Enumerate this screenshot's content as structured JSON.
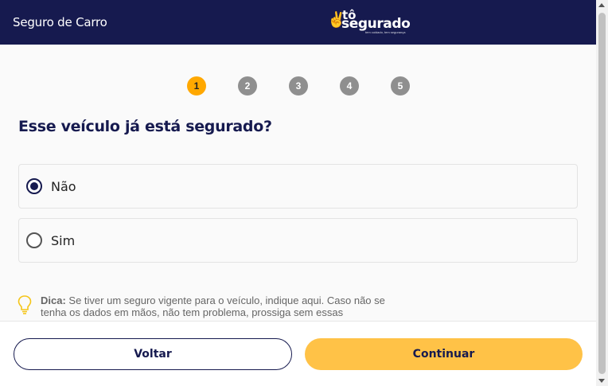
{
  "header": {
    "title": "Seguro de Carro",
    "logo": {
      "line1": "tô",
      "line2": "segurado",
      "tagline": "tem cuidado, tem segurança",
      "icon": "hand-peace-icon"
    }
  },
  "steps": [
    "1",
    "2",
    "3",
    "4",
    "5"
  ],
  "current_step": 1,
  "question": "Esse veículo já está segurado?",
  "options": [
    {
      "label": "Não",
      "selected": true
    },
    {
      "label": "Sim",
      "selected": false
    }
  ],
  "tip": {
    "prefix": "Dica:",
    "text": " Se tiver um seguro vigente para o veículo, indique aqui. Caso não se tenha os dados em mãos, não tem problema, prossiga sem essas",
    "icon": "lightbulb-icon"
  },
  "footer": {
    "back_label": "Voltar",
    "continue_label": "Continuar"
  },
  "colors": {
    "navy": "#161a4f",
    "accent": "#ffa800",
    "button": "#ffc247",
    "inactive_step": "#8f8f8f"
  }
}
